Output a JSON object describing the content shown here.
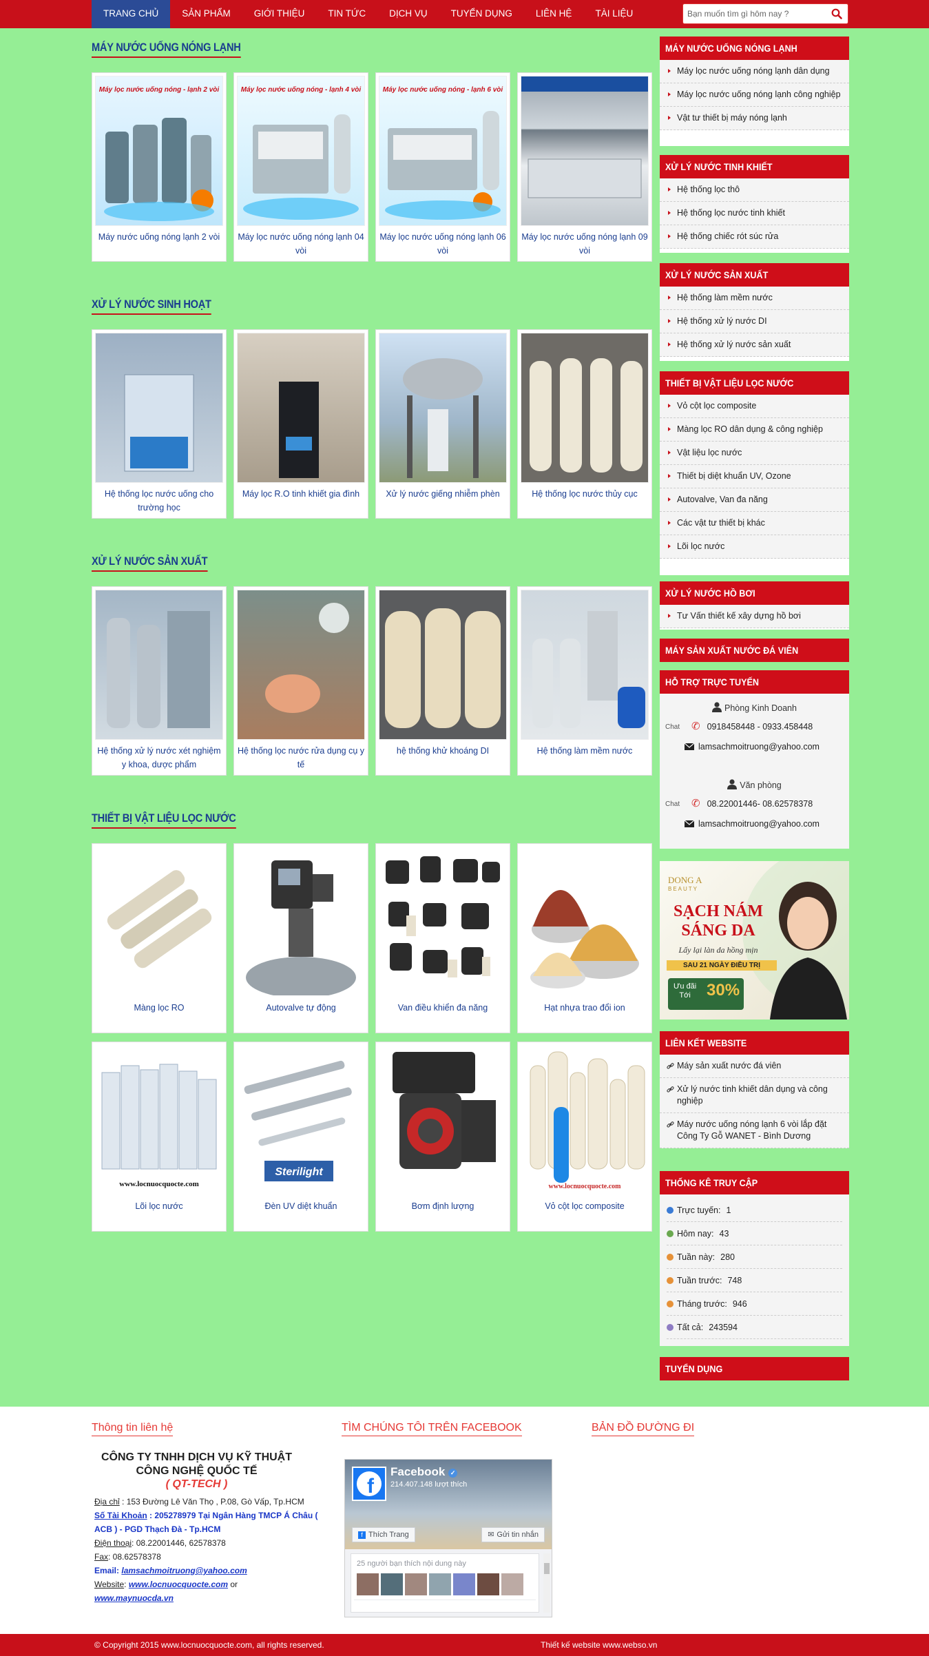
{
  "nav": {
    "items": [
      "Trang chủ",
      "Sản phẩm",
      "Giới thiệu",
      "Tin tức",
      "Dịch vụ",
      "Tuyển dụng",
      "Liên hệ",
      "Tài liệu"
    ],
    "active": "Trang chủ"
  },
  "search": {
    "placeholder": "Bạn muốn tìm gì hôm nay ?"
  },
  "sections": [
    {
      "title": "Máy nước uống nóng lạnh",
      "items": [
        "Máy nước uống nóng lạnh 2 vòi",
        "Máy lọc nước uống nóng lạnh 04 vòi",
        "Máy lọc nước uống nóng lạnh 06 vòi",
        "Máy lọc nước uống nóng lạnh 09 vòi"
      ]
    },
    {
      "title": "Xử lý nước sinh hoạt",
      "items": [
        "Hệ thống lọc nước uống cho trường học",
        "Máy lọc R.O tinh khiết gia đình",
        "Xử lý nước giếng nhiễm phèn",
        "Hệ thống lọc nước thủy cục"
      ]
    },
    {
      "title": "Xử lý nước sản xuất",
      "items": [
        "Hệ thống xử lý nước xét nghiệm y khoa, dược phẩm",
        "Hệ thống lọc nước rửa dụng cụ y tế",
        "hệ thống khử khoáng DI",
        "Hệ thống làm mềm nước"
      ]
    },
    {
      "title": "Thiết bị vật liệu lọc nước",
      "items": [
        "Màng lọc RO",
        "Autovalve tự động",
        "Van điều khiển đa năng",
        "Hạt nhựa trao đổi ion",
        "Lõi lọc nước",
        "Đèn UV diệt khuẩn",
        "Bơm định lượng",
        "Vỏ cột lọc composite"
      ]
    }
  ],
  "image_texts": {
    "hot_cold_2": "Máy lọc nước uống nóng - lạnh 2 vòi",
    "hot_cold_4": "Máy lọc nước uống nóng - lạnh 4 vòi",
    "hot_cold_6": "Máy lọc nước uống nóng - lạnh 6 vòi",
    "filter_site": "www.locnuocquocte.com",
    "sterilight": "Sterilight",
    "composite_site": "www.locnuocquocte.com"
  },
  "sidebar": {
    "hot_cold": {
      "title": "Máy nước uống nóng lạnh",
      "items": [
        "Máy lọc nước uống nóng lạnh dân dụng",
        "Máy lọc nước uống nóng lạnh công nghiệp",
        "Vật tư thiết bị máy nóng lạnh"
      ]
    },
    "pure": {
      "title": "Xử lý nước tinh khiết",
      "items": [
        "Hệ thống lọc thô",
        "Hệ thống lọc nước tinh khiết",
        "Hệ thống chiếc rót súc rửa"
      ]
    },
    "production": {
      "title": "Xử lý nước sản xuất",
      "items": [
        "Hệ thống làm mềm nước",
        "Hệ thống xử lý nước DI",
        "Hệ thống xử lý nước sản xuất"
      ]
    },
    "materials": {
      "title": "Thiết bị vật liệu lọc nước",
      "items": [
        "Vỏ cột lọc composite",
        "Màng lọc RO dân dụng & công nghiệp",
        "Vật liệu lọc nước",
        "Thiết bị diệt khuẩn UV, Ozone",
        "Autovalve, Van đa năng",
        "Các vật tư thiết bị khác",
        "Lõi lọc nước"
      ]
    },
    "pool": {
      "title": "Xử lý nước hồ bơi",
      "items": [
        "Tư Vấn thiết kế xây dựng hồ bơi"
      ]
    },
    "ice": {
      "title": "Máy sản xuất nước đá viên"
    },
    "support": {
      "title": "Hỗ trợ trực tuyến",
      "chat_alt": "Chat",
      "groups": [
        {
          "name": "Phòng Kinh Doanh",
          "phone": "0918458448 - 0933.458448",
          "email": "lamsachmoitruong@yahoo.com"
        },
        {
          "name": "Văn phòng",
          "phone": "08.22001446- 08.62578378",
          "email": "lamsachmoitruong@yahoo.com"
        }
      ]
    },
    "ad": {
      "brand": "DONG A",
      "brand_sub": "BEAUTY",
      "headline1": "SẠCH NÁM",
      "headline2": "SÁNG DA",
      "tagline": "Lấy lại làn da hồng mịn",
      "days": "SAU 21 NGÀY ĐIỀU TRỊ",
      "offer_label1": "Ưu đãi",
      "offer_label2": "Tới",
      "offer": "30%"
    },
    "links": {
      "title": "Liên kết website",
      "items": [
        "Máy sản xuất nước đá viên",
        "Xử lý nước tinh khiết dân dụng và công nghiệp",
        "Máy nước uống nóng lạnh 6 vòi lắp đặt Công Ty Gỗ WANET - Bình Dương"
      ]
    },
    "stats": {
      "title": "Thống kê truy cập",
      "rows": [
        {
          "label": "Trực tuyến:",
          "value": "1",
          "color": "#3a7bd5"
        },
        {
          "label": "Hôm nay:",
          "value": "43",
          "color": "#6aa84f"
        },
        {
          "label": "Tuần này:",
          "value": "280",
          "color": "#e69138"
        },
        {
          "label": "Tuần trước:",
          "value": "748",
          "color": "#e69138"
        },
        {
          "label": "Tháng trước:",
          "value": "946",
          "color": "#e69138"
        },
        {
          "label": "Tất cả:",
          "value": "243594",
          "color": "#8e7cc3"
        }
      ]
    },
    "jobs": {
      "title": "Tuyển dụng"
    }
  },
  "footer": {
    "contact": {
      "title": "Thông tin liên hệ",
      "company": "CÔNG TY TNHH DỊCH VỤ KỸ THUẬT CÔNG NGHỆ QUỐC TẾ",
      "short": "( QT-TECH )",
      "address_label": "Địa chỉ",
      "address": " :  153 Đường Lê Văn Thọ , P.08, Gò Vấp, Tp.HCM",
      "bank_label": "Số Tài Khoản",
      "bank": " : 205278979 Tại Ngân Hàng TMCP Á Châu ( ACB ) - PGD Thạch Đà - Tp.HCM",
      "phone_label": "Điện thoại",
      "phone": ": 08.22001446, 62578378",
      "fax_label": "Fax",
      "fax": ": 08.62578378",
      "email_label": "Email:",
      "email": "lamsachmoitruong@yahoo.com",
      "website_label": "Website",
      "website": "www.locnuocquocte.com",
      "or": " or",
      "website2": "www.maynuocda.vn"
    },
    "facebook": {
      "title": "Tìm chúng tôi trên Facebook",
      "page": "Facebook",
      "likes": "214.407.148 lượt thích",
      "like_btn": "Thích Trang",
      "msg_btn": "Gửi tin nhắn",
      "friends": "25 người bạn thích nội dung này"
    },
    "map": {
      "title": "Bản đồ đường đi"
    }
  },
  "bottom": {
    "copyright": "© Copyright 2015 www.locnuocquocte.com, all rights reserved.",
    "design": "Thiết kế website www.webso.vn"
  }
}
